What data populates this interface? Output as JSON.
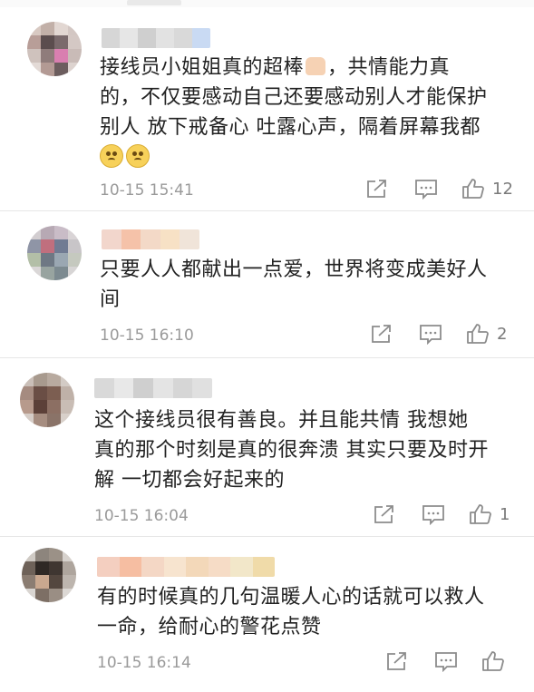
{
  "comments": [
    {
      "text_1": "接线员小姐姐真的超棒",
      "text_2": "，共情能力真",
      "text_3": "的，不仅要感动自己还要感动别人才能保护",
      "text_4": "别人 放下戒备心 吐露心声，隔着屏幕我都",
      "time": "10-15 15:41",
      "likes": "12"
    },
    {
      "text_1": "只要人人都献出一点爱，世界将变成美好人",
      "text_2": "间",
      "time": "10-15 16:10",
      "likes": "2"
    },
    {
      "text_1": "这个接线员很有善良。并且能共情 我想她",
      "text_2": "真的那个时刻是真的很奔溃 其实只要及时开",
      "text_3": "解 一切都会好起来的",
      "time": "10-15 16:04",
      "likes": "1"
    },
    {
      "text_1": "有的时候真的几句温暖人心的话就可以救人",
      "text_2": "一命，给耐心的警花点赞",
      "time": "10-15 16:14",
      "likes": ""
    }
  ],
  "icons": {
    "share": "share-icon",
    "comment": "comment-icon",
    "like": "thumbs-up-icon"
  },
  "colors": {
    "text": "#222222",
    "meta": "#9a9a9a",
    "icon": "#8c8c8c"
  }
}
